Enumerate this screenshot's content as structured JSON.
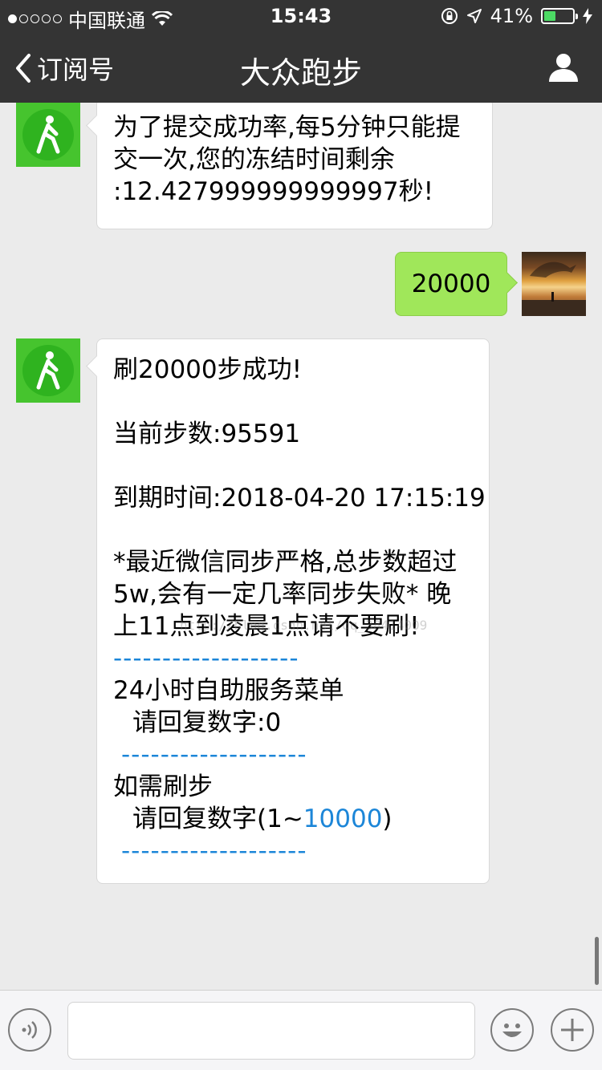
{
  "status_bar": {
    "carrier": "中国联通",
    "time": "15:43",
    "battery_percent_label": "41%",
    "battery_level": 0.41,
    "signal_dots_filled": 1
  },
  "nav": {
    "back_label": "订阅号",
    "title": "大众跑步"
  },
  "messages": {
    "m1": {
      "lines": [
        "为了提交成功率,每5分钟只能提",
        "交一次,您的冻结时间剩余",
        ":12.427999999999997秒!"
      ]
    },
    "m2": {
      "text": "20000"
    },
    "m3": {
      "l1": "刷20000步成功!",
      "l2": "当前步数:95591",
      "l3": "到期时间:2018-04-20 17:15:19",
      "l4": "*最近微信同步严格,总步数超过",
      "l5": "5w,会有一定几率同步失败* 晚",
      "l6": "上11点到凌晨1点请不要刷!",
      "dash1": "-------------------",
      "l7": "24小时自助服务菜单",
      "l8": "请回复数字:0",
      "dash2": "-------------------",
      "l9": "如需刷步",
      "l10_pre": "请回复数字(1~",
      "l10_link": "10000",
      "l10_post": ")",
      "dash3": "-------------------"
    }
  },
  "watermark": "http://blog.csdn.net/qq_38414009",
  "icons": {
    "back": "chevron-left-icon",
    "user": "person-icon",
    "voice": "voice-icon",
    "emoji": "emoji-icon",
    "plus": "plus-icon"
  },
  "colors": {
    "bar": "#343434",
    "bubble_out": "#a0e75a",
    "app_avatar": "#46c42e",
    "link": "#1c86d8"
  }
}
